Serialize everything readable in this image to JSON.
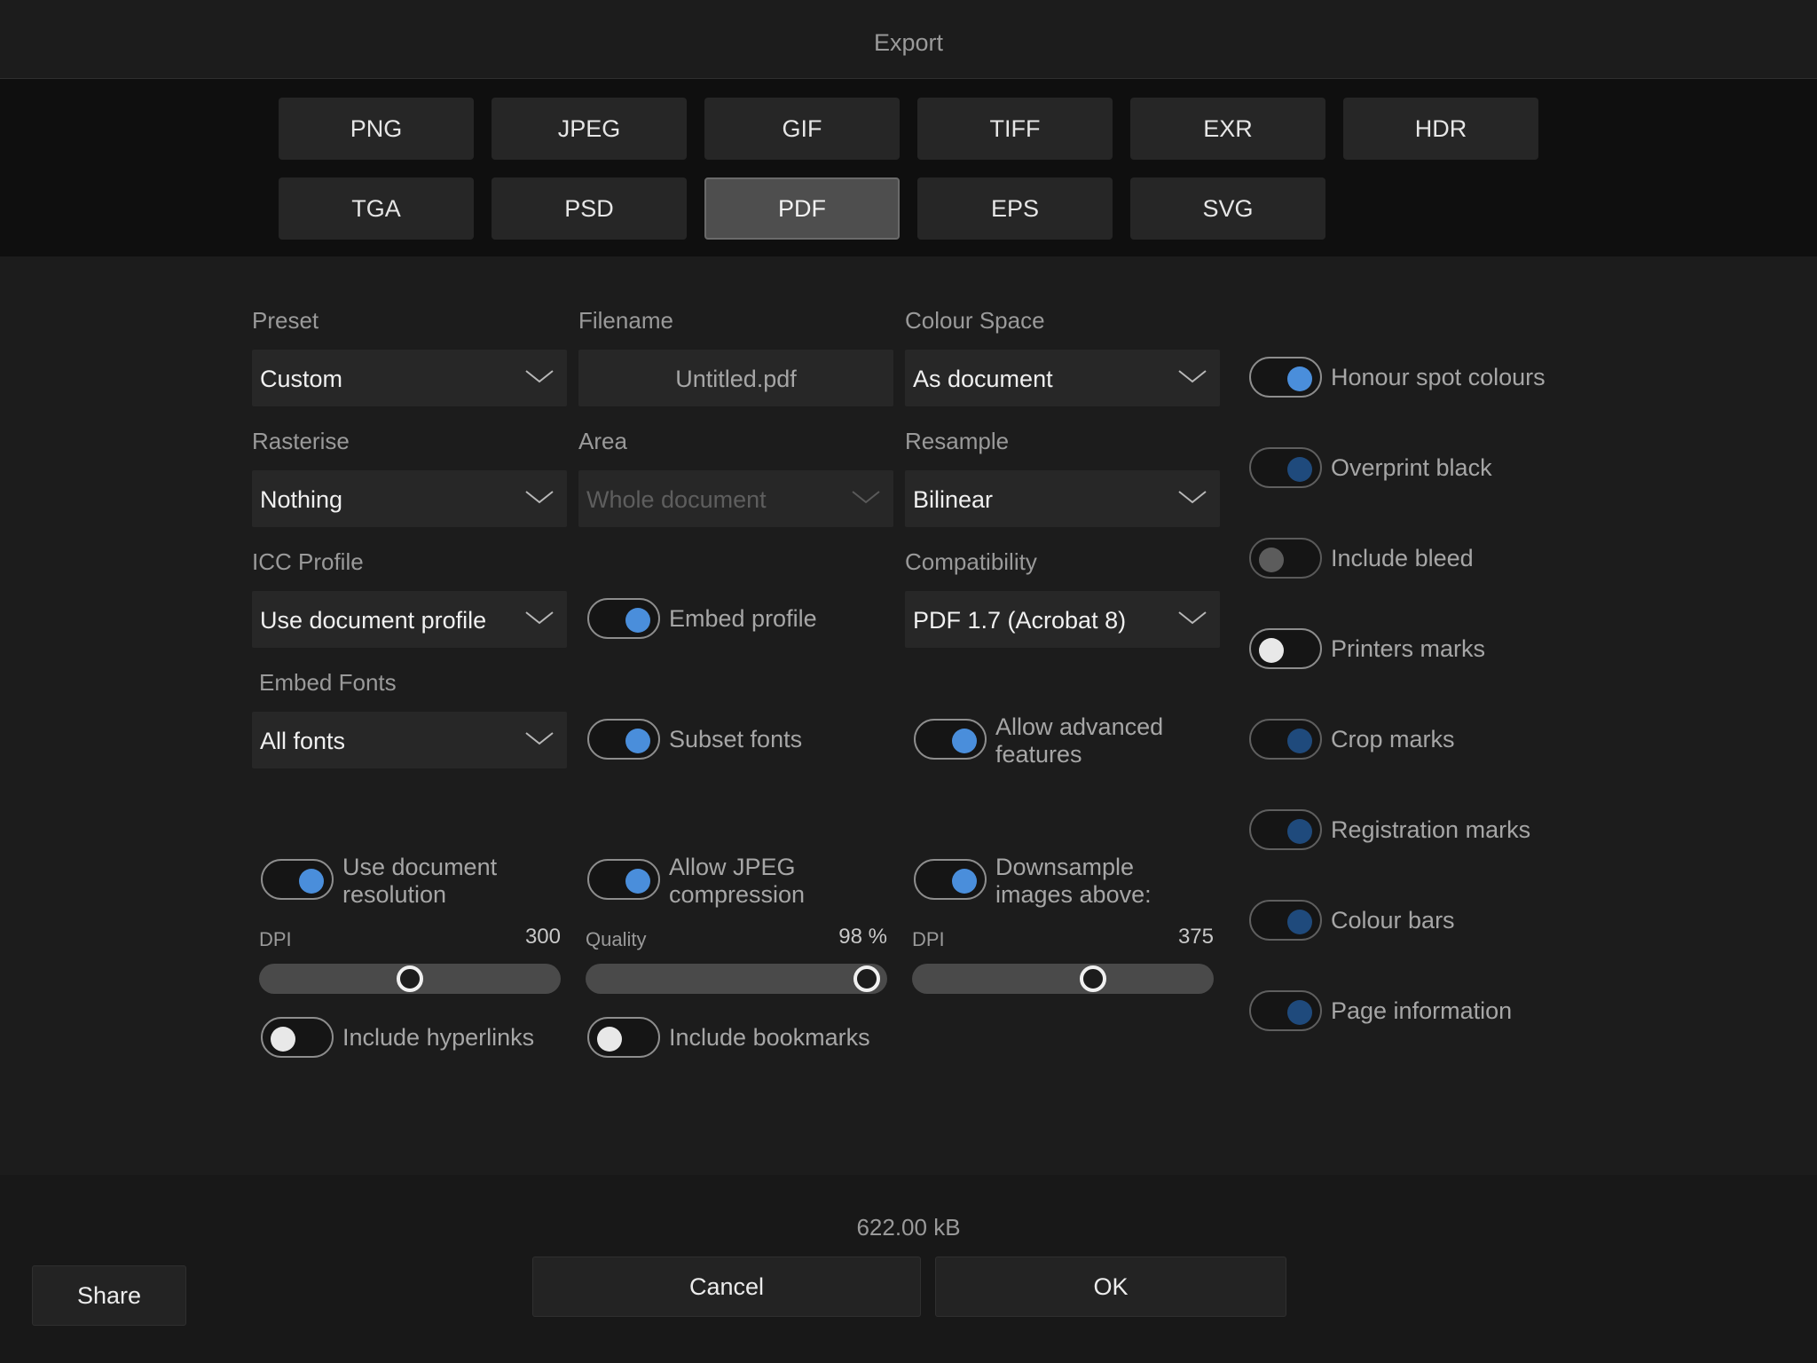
{
  "title": "Export",
  "formats": [
    "PNG",
    "JPEG",
    "GIF",
    "TIFF",
    "EXR",
    "HDR",
    "TGA",
    "PSD",
    "PDF",
    "EPS",
    "SVG"
  ],
  "selected_format": "PDF",
  "preset": {
    "label": "Preset",
    "value": "Custom"
  },
  "filename": {
    "label": "Filename",
    "value": "Untitled.pdf"
  },
  "colour_space": {
    "label": "Colour Space",
    "value": "As document"
  },
  "rasterise": {
    "label": "Rasterise",
    "value": "Nothing"
  },
  "area": {
    "label": "Area",
    "value": "Whole document"
  },
  "resample": {
    "label": "Resample",
    "value": "Bilinear"
  },
  "icc_profile": {
    "label": "ICC Profile",
    "value": "Use document profile"
  },
  "compatibility": {
    "label": "Compatibility",
    "value": "PDF 1.7 (Acrobat 8)"
  },
  "embed_fonts": {
    "label": "Embed Fonts",
    "value": "All fonts"
  },
  "toggles": {
    "embed_profile": {
      "label": "Embed profile",
      "on": true
    },
    "subset_fonts": {
      "label": "Subset fonts",
      "on": true
    },
    "allow_advanced": {
      "line1": "Allow advanced",
      "line2": "features",
      "on": true
    },
    "use_doc_res": {
      "line1": "Use document",
      "line2": "resolution",
      "on": true
    },
    "allow_jpeg": {
      "line1": "Allow JPEG",
      "line2": "compression",
      "on": true
    },
    "downsample": {
      "line1": "Downsample",
      "line2": "images above:",
      "on": true
    },
    "include_hyperlinks": {
      "label": "Include hyperlinks",
      "on": false
    },
    "include_bookmarks": {
      "label": "Include bookmarks",
      "on": false
    }
  },
  "right_toggles": [
    {
      "label": "Honour spot colours",
      "on": true
    },
    {
      "label": "Overprint black",
      "on": true
    },
    {
      "label": "Include bleed",
      "on": false
    },
    {
      "label": "Printers marks",
      "on": false
    },
    {
      "label": "Crop marks",
      "on": true
    },
    {
      "label": "Registration marks",
      "on": true
    },
    {
      "label": "Colour bars",
      "on": true
    },
    {
      "label": "Page information",
      "on": true
    }
  ],
  "sliders": {
    "dpi1": {
      "label": "DPI",
      "value_text": "300",
      "fraction": 0.5
    },
    "quality": {
      "label": "Quality",
      "value_text": "98 %",
      "fraction": 0.98
    },
    "dpi2": {
      "label": "DPI",
      "value_text": "375",
      "fraction": 0.61
    }
  },
  "file_size": "622.00 kB",
  "buttons": {
    "share": "Share",
    "cancel": "Cancel",
    "ok": "OK"
  }
}
